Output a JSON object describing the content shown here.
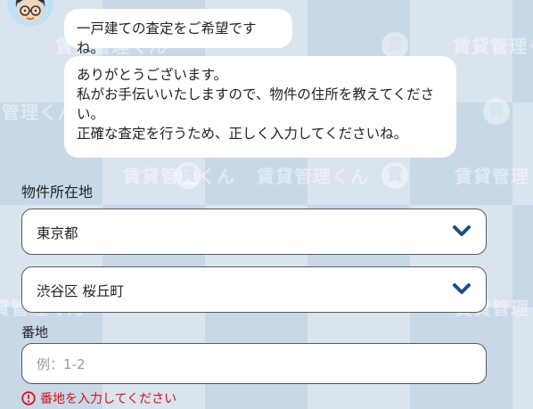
{
  "chat": {
    "message_1": "一戸建ての査定をご希望ですね。",
    "message_2_lines": [
      "ありがとうございます。",
      "私がお手伝いいたしますので、物件の住所を教えてくださ",
      "い。",
      "正確な査定を行うため、正しく入力してくださいね。"
    ]
  },
  "form": {
    "location_label": "物件所在地",
    "prefecture_value": "東京都",
    "city_value": "渋谷区 桜丘町",
    "banchi_label": "番地",
    "banchi_placeholder": "例：1-2",
    "banchi_value": "",
    "error_message": "番地を入力してください"
  },
  "background": {
    "watermark_text": "賃貸管理くん",
    "watermark_badge": "賃"
  },
  "colors": {
    "accent": "#1b4f82",
    "error": "#d8121c",
    "border": "#555b62"
  },
  "icons": {
    "select_icon": "chevron-down-icon",
    "error_icon": "alert-circle-icon",
    "avatar": "assistant-avatar"
  }
}
